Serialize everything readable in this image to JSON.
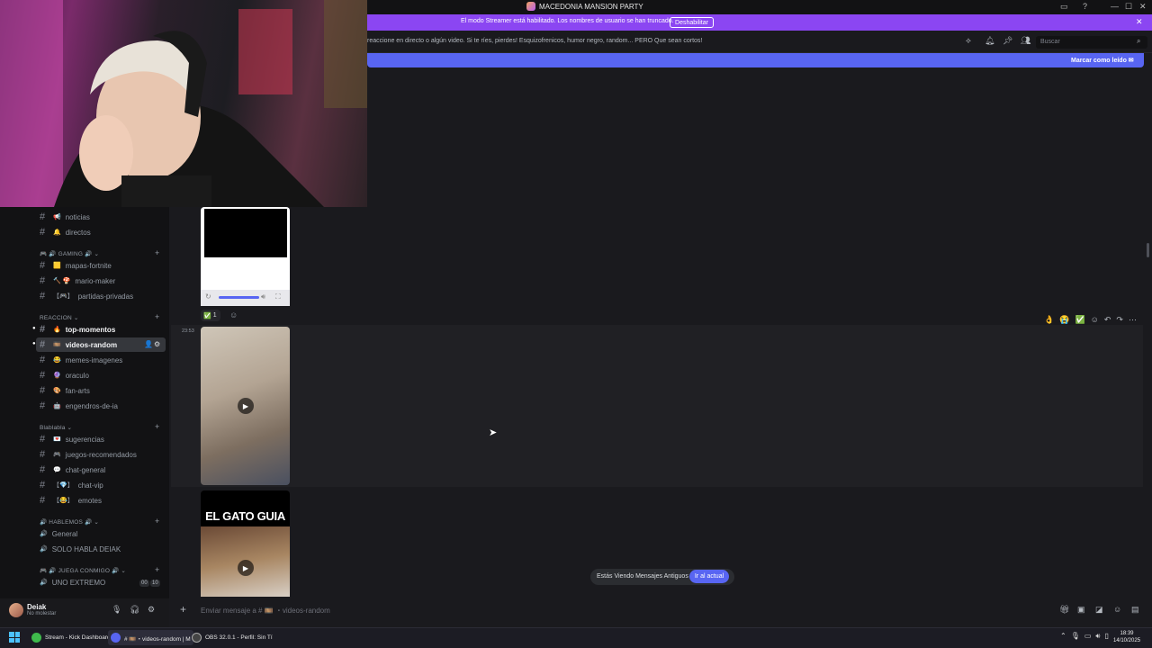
{
  "window": {
    "title": "MACEDONIA MANSION PARTY",
    "minimize": "—",
    "maximize": "☐",
    "close": "✕"
  },
  "streamer_mode": {
    "message": "El modo Streamer está habilitado. Los nombres de usuario se han truncado.",
    "button": "Deshabilitar",
    "close": "✕"
  },
  "channel_topic": "reaccione en directo o algún video. Si te ríes, pierdes! Esquizofrenicos, humor negro, random... PERO Que sean cortos!",
  "search": {
    "placeholder": "Buscar"
  },
  "unread_banner": {
    "label": "Marcar como leído"
  },
  "sidebar": {
    "channels_top": [
      {
        "emoji": "📢",
        "name": "noticias"
      },
      {
        "emoji": "🔔",
        "name": "directos"
      }
    ],
    "categories": [
      {
        "name": "🎮 🔊 GAMING 🔊 ⌄",
        "channels": [
          {
            "emoji": "🟨",
            "name": "mapas-fortnite"
          },
          {
            "emoji": "🔨 🍄",
            "name": "mario-maker"
          },
          {
            "emoji": "【🎮】",
            "name": "partidas-privadas"
          }
        ]
      },
      {
        "name": "REACCION ⌄",
        "channels": [
          {
            "emoji": "🔥",
            "name": "top-momentos"
          },
          {
            "emoji": "🎞️",
            "name": "videos-random"
          },
          {
            "emoji": "😂",
            "name": "memes-imagenes"
          },
          {
            "emoji": "🔮",
            "name": "oraculo"
          },
          {
            "emoji": "🎨",
            "name": "fan-arts"
          },
          {
            "emoji": "🤖",
            "name": "engendros-de-ia"
          }
        ]
      },
      {
        "name": "Blablabla ⌄",
        "channels": [
          {
            "emoji": "💌",
            "name": "sugerencias"
          },
          {
            "emoji": "🎮",
            "name": "juegos-recomendados"
          },
          {
            "emoji": "💬",
            "name": "chat-general"
          },
          {
            "emoji": "【💎】",
            "name": "chat-vip"
          },
          {
            "emoji": "【😂】",
            "name": "emotes"
          }
        ]
      },
      {
        "name": "🔊 HABLEMOS 🔊 ⌄",
        "channels": [
          {
            "emoji": "🔊",
            "name": "General"
          },
          {
            "emoji": "🔊",
            "name": "SOLO HABLA DEIAK"
          }
        ]
      },
      {
        "name": "🎮 🔊 JUEGA CONMIGO 🔊 ⌄",
        "channels": [
          {
            "emoji": "🔊",
            "name": "UNO EXTREMO"
          }
        ]
      }
    ],
    "voice_badges": [
      "00",
      "10"
    ]
  },
  "user": {
    "name": "Deiak",
    "status": "No molestar"
  },
  "messages": {
    "reaction": {
      "emoji": "✅",
      "count": "1"
    },
    "timestamp": "23:53",
    "video3_title": "EL GATO GUIA"
  },
  "composer": {
    "placeholder": "Enviar mensaje a # 🎞️ ・videos-random"
  },
  "old_messages": {
    "label": "Estás Viendo Mensajes Antiguos",
    "jump": "Ir al actual"
  },
  "taskbar": {
    "apps": [
      {
        "label": "Stream - Kick Dashboard",
        "color": "#3fba4c"
      },
      {
        "label": "# 🎞️・videos-random | M",
        "color": "#5865f2"
      },
      {
        "label": "OBS 32.0.1 - Perfil: Sin Tí",
        "color": "#444"
      }
    ],
    "time": "18:39",
    "date": "14/10/2025"
  }
}
